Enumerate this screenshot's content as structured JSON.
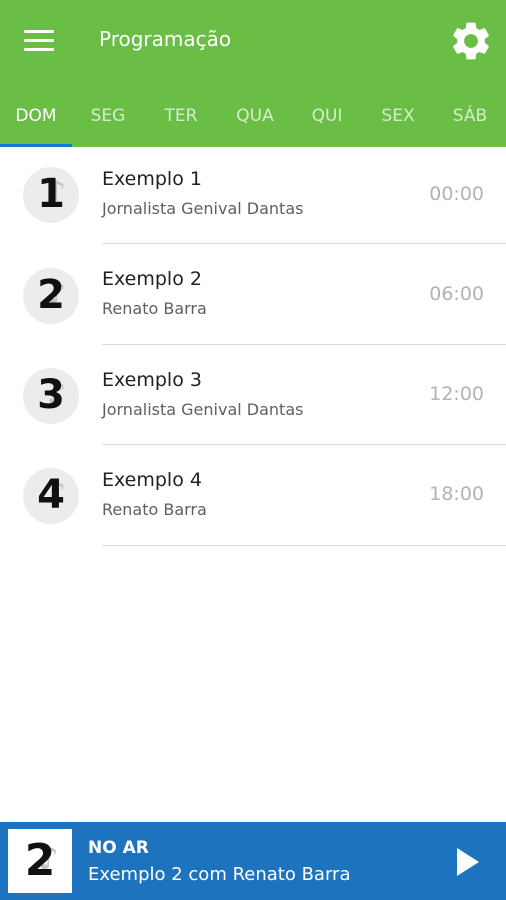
{
  "header": {
    "title": "Programação",
    "menu_icon": "menu-icon",
    "settings_icon": "gear-icon"
  },
  "tabs": [
    {
      "label": "DOM",
      "active": true
    },
    {
      "label": "SEG",
      "active": false
    },
    {
      "label": "TER",
      "active": false
    },
    {
      "label": "QUA",
      "active": false
    },
    {
      "label": "QUI",
      "active": false
    },
    {
      "label": "SEX",
      "active": false
    },
    {
      "label": "SÁB",
      "active": false
    }
  ],
  "schedule": [
    {
      "number": "1",
      "title": "Exemplo 1",
      "host": "Jornalista Genival Dantas",
      "time": "00:00"
    },
    {
      "number": "2",
      "title": "Exemplo 2",
      "host": "Renato Barra",
      "time": "06:00"
    },
    {
      "number": "3",
      "title": "Exemplo 3",
      "host": "Jornalista Genival Dantas",
      "time": "12:00"
    },
    {
      "number": "4",
      "title": "Exemplo 4",
      "host": "Renato Barra",
      "time": "18:00"
    }
  ],
  "player": {
    "number": "2",
    "label": "NO AR",
    "text": "Exemplo 2 com Renato Barra",
    "play_icon": "play-icon"
  },
  "colors": {
    "appbar": "#6abd45",
    "tab_indicator": "#1976d2",
    "player": "#1e73be"
  }
}
